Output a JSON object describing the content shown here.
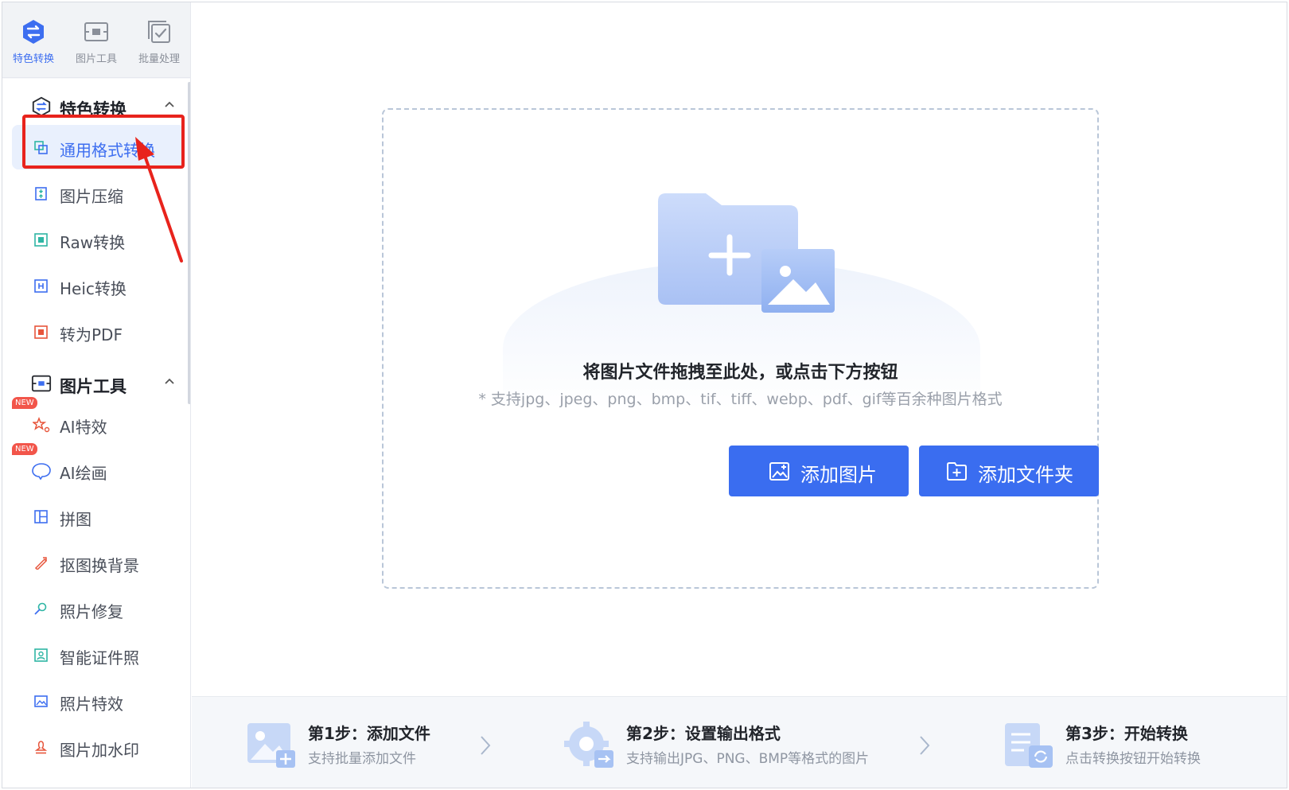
{
  "topnav": [
    {
      "label": "特色转换",
      "icon": "swap-hexagon-icon",
      "active": true
    },
    {
      "label": "图片工具",
      "icon": "image-tool-icon",
      "active": false
    },
    {
      "label": "批量处理",
      "icon": "batch-check-icon",
      "active": false
    }
  ],
  "sidebar": {
    "group_convert": {
      "title": "特色转换",
      "icon": "swap-hexagon-icon"
    },
    "convert_items": [
      {
        "label": "通用格式转换",
        "icon": "format-convert-icon"
      },
      {
        "label": "图片压缩",
        "icon": "compress-icon"
      },
      {
        "label": "Raw转换",
        "icon": "raw-icon"
      },
      {
        "label": "Heic转换",
        "icon": "heic-icon"
      },
      {
        "label": "转为PDF",
        "icon": "pdf-icon"
      }
    ],
    "group_tools": {
      "title": "图片工具",
      "icon": "image-tool-icon"
    },
    "tool_items": [
      {
        "label": "AI特效",
        "icon": "ai-effect-icon",
        "badge": "NEW"
      },
      {
        "label": "AI绘画",
        "icon": "ai-paint-icon",
        "badge": "NEW"
      },
      {
        "label": "拼图",
        "icon": "collage-icon"
      },
      {
        "label": "抠图换背景",
        "icon": "cutout-icon"
      },
      {
        "label": "照片修复",
        "icon": "repair-icon"
      },
      {
        "label": "智能证件照",
        "icon": "id-photo-icon"
      },
      {
        "label": "照片特效",
        "icon": "photo-effect-icon"
      },
      {
        "label": "图片加水印",
        "icon": "watermark-icon"
      }
    ]
  },
  "dropzone": {
    "title": "将图片文件拖拽至此处，或点击下方按钮",
    "subtitle": "* 支持jpg、jpeg、png、bmp、tif、tiff、webp、pdf、gif等百余种图片格式",
    "add_images": "添加图片",
    "add_folder": "添加文件夹"
  },
  "steps": [
    {
      "title": "第1步：添加文件",
      "desc": "支持批量添加文件"
    },
    {
      "title": "第2步：设置输出格式",
      "desc": "支持输出JPG、PNG、BMP等格式的图片"
    },
    {
      "title": "第3步：开始转换",
      "desc": "点击转换按钮开始转换"
    }
  ],
  "colors": {
    "accent": "#3a6df0",
    "annotation_red": "#e8231c",
    "new_badge": "#f2554a"
  }
}
